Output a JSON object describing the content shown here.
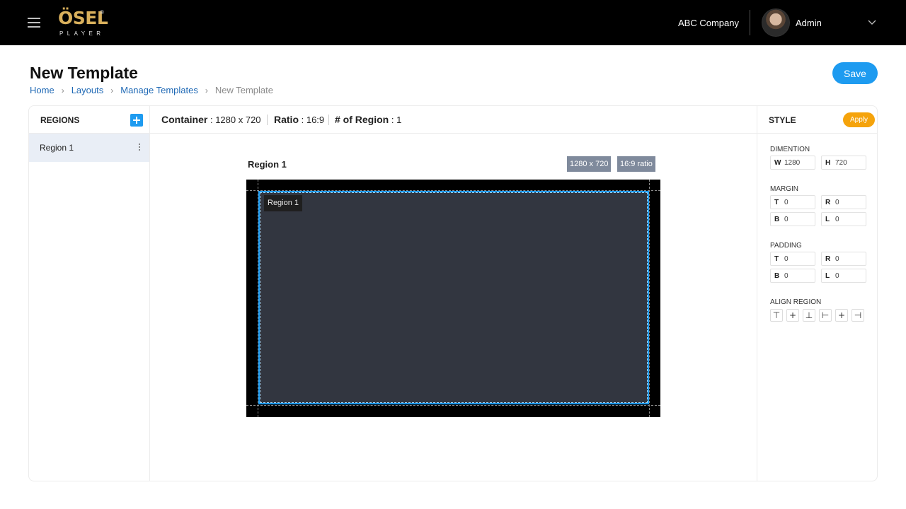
{
  "topbar": {
    "logo_main": "ÖSEL",
    "logo_reg": "®",
    "logo_sub": "PLAYER",
    "company": "ABC Company",
    "user_name": "Admin"
  },
  "header": {
    "title": "New Template",
    "save_label": "Save",
    "breadcrumb": [
      {
        "label": "Home"
      },
      {
        "label": "Layouts"
      },
      {
        "label": "Manage Templates"
      },
      {
        "label": "New Template"
      }
    ]
  },
  "regions_panel": {
    "title": "REGIONS",
    "items": [
      {
        "label": "Region 1"
      }
    ]
  },
  "canvas_header": {
    "container_label": "Container",
    "container_value": ": 1280 x 720",
    "ratio_label": "Ratio",
    "ratio_value": ": 16:9",
    "regions_label": "# of Region",
    "regions_value": ": 1"
  },
  "preview": {
    "region_title": "Region 1",
    "size_tag": "1280 x 720",
    "ratio_tag": "16:9 ratio",
    "region_badge": "Region 1"
  },
  "style_panel": {
    "title": "STYLE",
    "apply_label": "Apply",
    "dimension": {
      "label": "DIMENTION",
      "w_label": "W",
      "w_value": "1280",
      "h_label": "H",
      "h_value": "720"
    },
    "margin": {
      "label": "MARGIN",
      "t_label": "T",
      "t_value": "0",
      "r_label": "R",
      "r_value": "0",
      "b_label": "B",
      "b_value": "0",
      "l_label": "L",
      "l_value": "0"
    },
    "padding": {
      "label": "PADDING",
      "t_label": "T",
      "t_value": "0",
      "r_label": "R",
      "r_value": "0",
      "b_label": "B",
      "b_value": "0",
      "l_label": "L",
      "l_value": "0"
    },
    "align": {
      "label": "ALIGN REGION"
    }
  },
  "icons": [
    "hamburger-icon",
    "chevron-down-icon",
    "plus-icon",
    "kebab-icon",
    "chevron-right-icon",
    "align-top-icon",
    "align-middle-icon",
    "align-bottom-icon",
    "align-left-icon",
    "align-center-icon",
    "align-right-icon"
  ],
  "colors": {
    "accent": "#1e9bf0",
    "apply": "#f5a30b",
    "topbar": "#000000",
    "logo": "#d9b05c",
    "region_fill": "#323640",
    "tag": "#7f8a9c",
    "link": "#1f69b5"
  }
}
